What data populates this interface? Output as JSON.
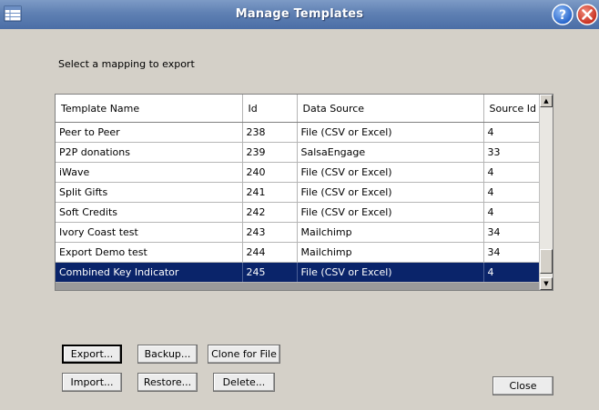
{
  "window": {
    "title": "Manage Templates"
  },
  "prompt": "Select a mapping to export",
  "table": {
    "columns": [
      "Template Name",
      "Id",
      "Data Source",
      "Source Id"
    ],
    "rows": [
      [
        "Peer to Peer",
        "238",
        "File (CSV or Excel)",
        "4"
      ],
      [
        "P2P donations",
        "239",
        "SalsaEngage",
        "33"
      ],
      [
        "iWave",
        "240",
        "File (CSV or Excel)",
        "4"
      ],
      [
        "Split Gifts",
        "241",
        "File (CSV or Excel)",
        "4"
      ],
      [
        "Soft Credits",
        "242",
        "File (CSV or Excel)",
        "4"
      ],
      [
        "Ivory Coast test",
        "243",
        "Mailchimp",
        "34"
      ],
      [
        "Export Demo test",
        "244",
        "Mailchimp",
        "34"
      ],
      [
        "Combined Key Indicator",
        "245",
        "File (CSV or Excel)",
        "4"
      ]
    ],
    "selected_row": 7
  },
  "buttons": {
    "export": "Export...",
    "backup": "Backup...",
    "clone": "Clone for File",
    "import": "Import...",
    "restore": "Restore...",
    "delete": "Delete...",
    "close": "Close"
  },
  "icons": {
    "app": "table-icon",
    "help": "help-icon",
    "close": "close-icon"
  },
  "colors": {
    "selection": "#0a246a",
    "titlebar": "#5f80b3",
    "help": "#2a6bd6",
    "close": "#d23a2a"
  }
}
